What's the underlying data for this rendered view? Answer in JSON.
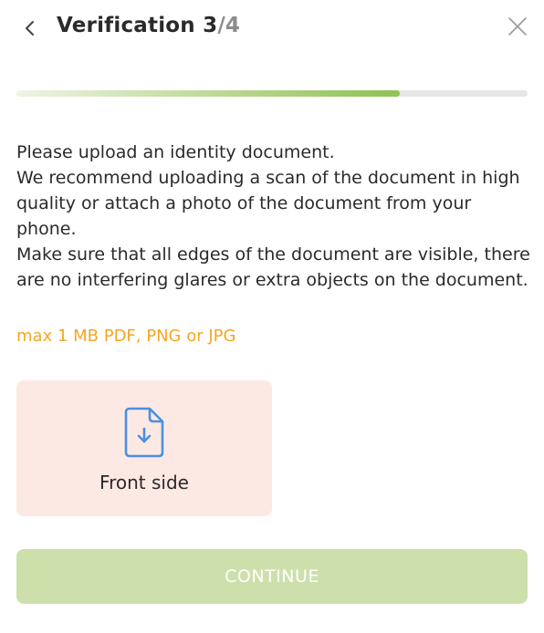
{
  "header": {
    "title": "Verification",
    "step_current": "3",
    "step_separator": "/",
    "step_total": "4",
    "back_icon": "chevron-left-icon",
    "close_icon": "close-icon"
  },
  "progress": {
    "fraction": 0.75,
    "fill_color": "#8fc154",
    "track_color": "#e6e6e6"
  },
  "description": {
    "lines": [
      "Please upload an identity document.",
      "We recommend uploading a scan of the document in high quality or attach a photo of the document from your phone.",
      "Make sure that all edges of the document are visible, there are no interfering glares or extra objects on the document."
    ],
    "hint": "max 1 MB PDF, PNG or JPG",
    "hint_color": "#f5a623"
  },
  "upload": {
    "icon": "file-download-icon",
    "label": "Front side",
    "background_color": "#fde9e4",
    "icon_color": "#4a90e2"
  },
  "continue_button": {
    "label": "CONTINUE",
    "background_color": "#cde0ac"
  }
}
